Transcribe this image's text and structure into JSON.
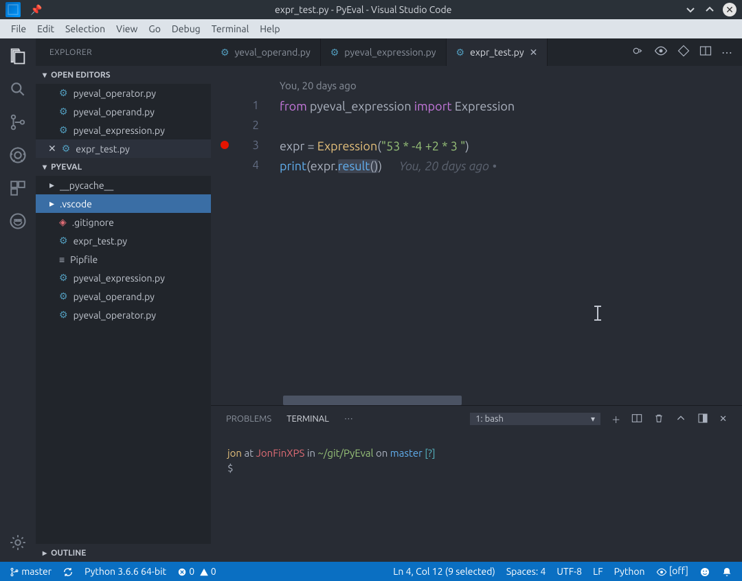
{
  "window": {
    "title": "expr_test.py - PyEval - Visual Studio Code"
  },
  "menu": [
    "File",
    "Edit",
    "Selection",
    "View",
    "Go",
    "Debug",
    "Terminal",
    "Help"
  ],
  "activity": [
    "files",
    "search",
    "scm",
    "debug",
    "extensions",
    "docker"
  ],
  "sidebar": {
    "title": "EXPLORER",
    "openEditors": "OPEN EDITORS",
    "editors": [
      {
        "name": "pyeval_operator.py"
      },
      {
        "name": "pyeval_operand.py"
      },
      {
        "name": "pyeval_expression.py"
      },
      {
        "name": "expr_test.py",
        "active": true
      }
    ],
    "workspace": "PYEVAL",
    "files": [
      {
        "name": "__pycache__",
        "type": "folder"
      },
      {
        "name": ".vscode",
        "type": "folder",
        "selected": true
      },
      {
        "name": ".gitignore",
        "type": "git"
      },
      {
        "name": "expr_test.py",
        "type": "py"
      },
      {
        "name": "Pipfile",
        "type": "txt"
      },
      {
        "name": "pyeval_expression.py",
        "type": "py"
      },
      {
        "name": "pyeval_operand.py",
        "type": "py"
      },
      {
        "name": "pyeval_operator.py",
        "type": "py"
      }
    ],
    "outline": "OUTLINE"
  },
  "tabs": [
    {
      "name": "yeval_operand.py"
    },
    {
      "name": "pyeval_expression.py"
    },
    {
      "name": "expr_test.py",
      "active": true
    }
  ],
  "code": {
    "codelens": "You, 20 days ago",
    "l1_from": "from",
    "l1_mod": "pyeval_expression",
    "l1_import": "import",
    "l1_cls": "Expression",
    "l3_var": "expr",
    "l3_eq": " = ",
    "l3_cls": "Expression",
    "l3_p": "(",
    "l3_str": "\"53 *  -4 +2 *  3  \"",
    "l3_cp": ")",
    "l4_print": "print",
    "l4_p": "(",
    "l4_var": "expr",
    "l4_dot": ".",
    "l4_res": "result",
    "l4_call": "()",
    "l4_cp": ")",
    "l4_blame": "You, 20 days ago •"
  },
  "panel": {
    "problems": "PROBLEMS",
    "terminal": "TERMINAL",
    "select": "1: bash",
    "prompt": {
      "user": "jon",
      "at": "at",
      "host": "JonFinXPS",
      "in": "in",
      "path": "~/git/PyEval",
      "on": "on",
      "branch": "master",
      "q": "[?]",
      "dollar": "$"
    }
  },
  "status": {
    "branch": "master",
    "python": "Python 3.6.6 64-bit",
    "errors": "0",
    "warnings": "0",
    "pos": "Ln 4, Col 12 (9 selected)",
    "spaces": "Spaces: 4",
    "enc": "UTF-8",
    "eol": "LF",
    "lang": "Python",
    "preview": "[off]"
  }
}
